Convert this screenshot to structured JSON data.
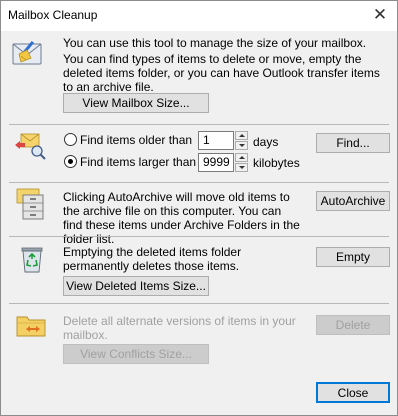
{
  "window": {
    "title": "Mailbox Cleanup",
    "close_glyph": "✕"
  },
  "mailbox_size": {
    "text_line1": "You can use this tool to manage the size of your mailbox.",
    "text_rest": "You can find types of items to delete or move, empty the deleted items folder, or you can have Outlook transfer items to an archive file.",
    "button_label": "View Mailbox Size...",
    "icon": "mailbox-cleanup-broom-icon"
  },
  "find": {
    "icon": "find-items-envelope-icon",
    "older_label": "Find items older than",
    "older_value": "1",
    "older_unit": "days",
    "larger_label": "Find items larger than",
    "larger_value": "9999",
    "larger_unit": "kilobytes",
    "selected_option": "larger",
    "button_label": "Find..."
  },
  "autoarchive": {
    "icon": "autoarchive-cabinet-icon",
    "text": "Clicking AutoArchive will move old items to the archive file on this computer. You can find these items under Archive Folders in the folder list.",
    "button_label": "AutoArchive"
  },
  "deleted_items": {
    "icon": "recycle-bin-icon",
    "text": "Emptying the deleted items folder permanently deletes those items.",
    "view_button_label": "View Deleted Items Size...",
    "empty_button_label": "Empty"
  },
  "conflicts": {
    "icon": "conflicts-folder-icon",
    "text": "Delete all alternate versions of items in your mailbox.",
    "view_button_label": "View Conflicts Size...",
    "delete_button_label": "Delete",
    "enabled": false
  },
  "footer": {
    "close_button_label": "Close"
  }
}
